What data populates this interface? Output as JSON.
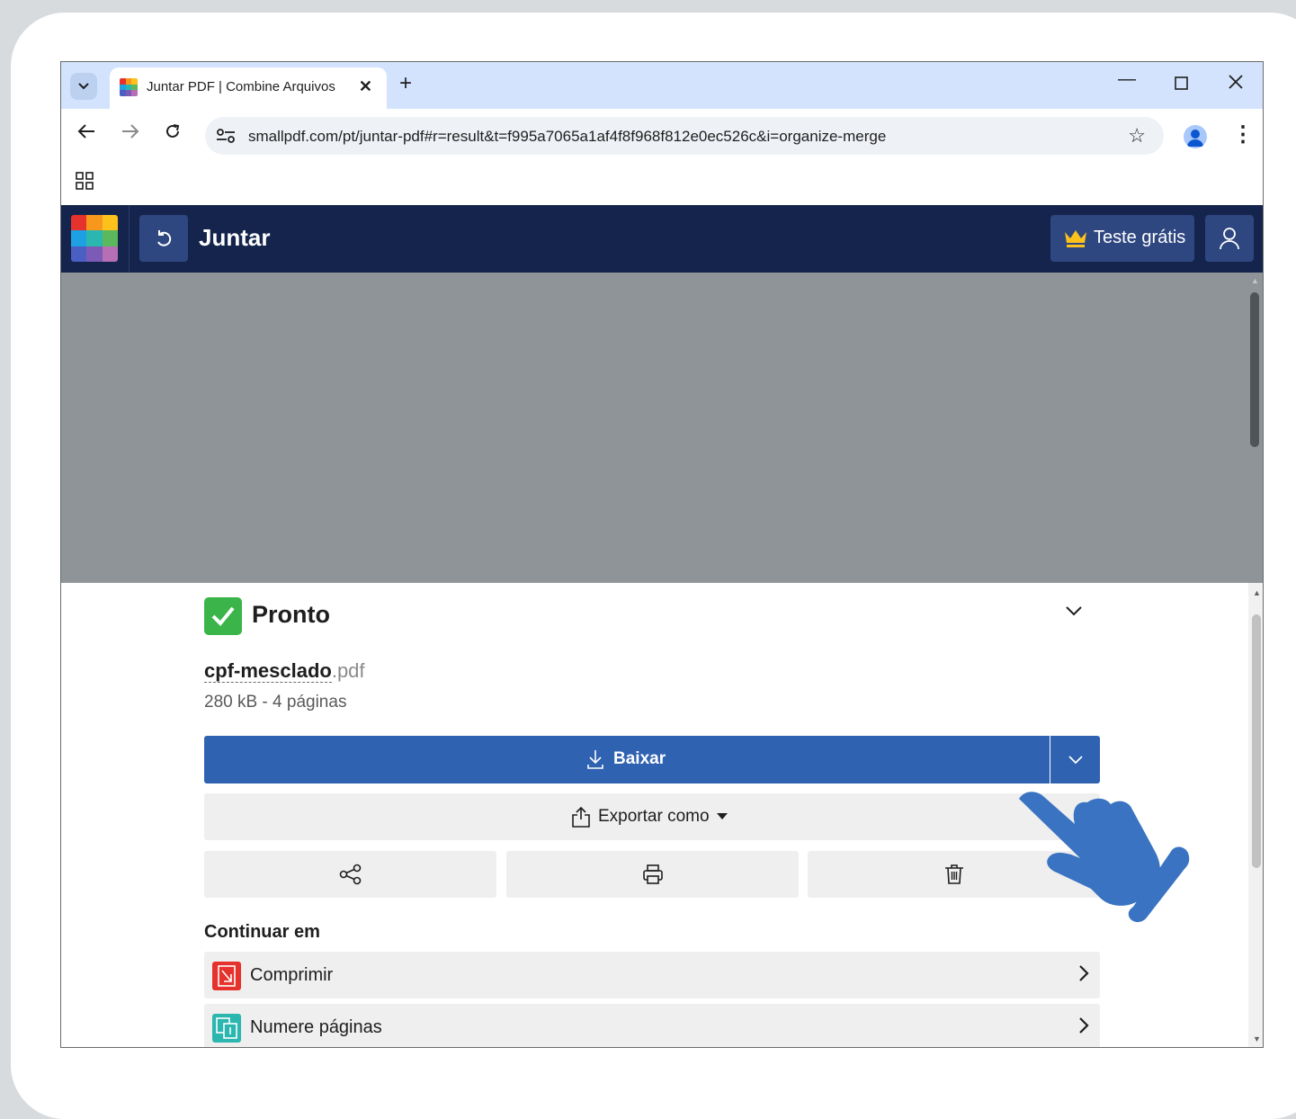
{
  "browser": {
    "tab": {
      "title": "Juntar PDF | Combine Arquivos"
    },
    "address": {
      "url": "smallpdf.com/pt/juntar-pdf#r=result&t=f995a7065a1af4f8f968f812e0ec526c&i=organize-merge"
    }
  },
  "app": {
    "title": "Juntar",
    "trial_label": "Teste grátis"
  },
  "result": {
    "status": "Pronto",
    "file_base": "cpf-mesclado",
    "file_ext": ".pdf",
    "meta": "280 kB - 4 páginas",
    "download_label": "Baixar",
    "export_label": "Exportar como"
  },
  "continue": {
    "heading": "Continuar em",
    "items": [
      {
        "label": "Comprimir",
        "color": "#e5322d"
      },
      {
        "label": "Numere páginas",
        "color": "#2bb6b0"
      }
    ]
  },
  "colors": {
    "app_header": "#14244c",
    "primary_button": "#2f62b0",
    "success": "#3bb54a",
    "overlay_hand": "#3a73c2"
  },
  "icons": [
    "tab-search-icon",
    "favicon",
    "close-icon",
    "new-tab-icon",
    "minimize-icon",
    "maximize-icon",
    "close-window-icon",
    "back-icon",
    "forward-icon",
    "reload-icon",
    "site-settings-icon",
    "bookmark-star-icon",
    "profile-icon",
    "more-menu-icon",
    "apps-icon",
    "smallpdf-logo",
    "undo-icon",
    "crown-icon",
    "user-icon",
    "check-icon",
    "chevron-down-icon",
    "download-icon",
    "export-icon",
    "caret-down-icon",
    "share-icon",
    "print-icon",
    "trash-icon",
    "compress-icon",
    "number-pages-icon",
    "chevron-right-icon",
    "pointing-hand-icon"
  ]
}
